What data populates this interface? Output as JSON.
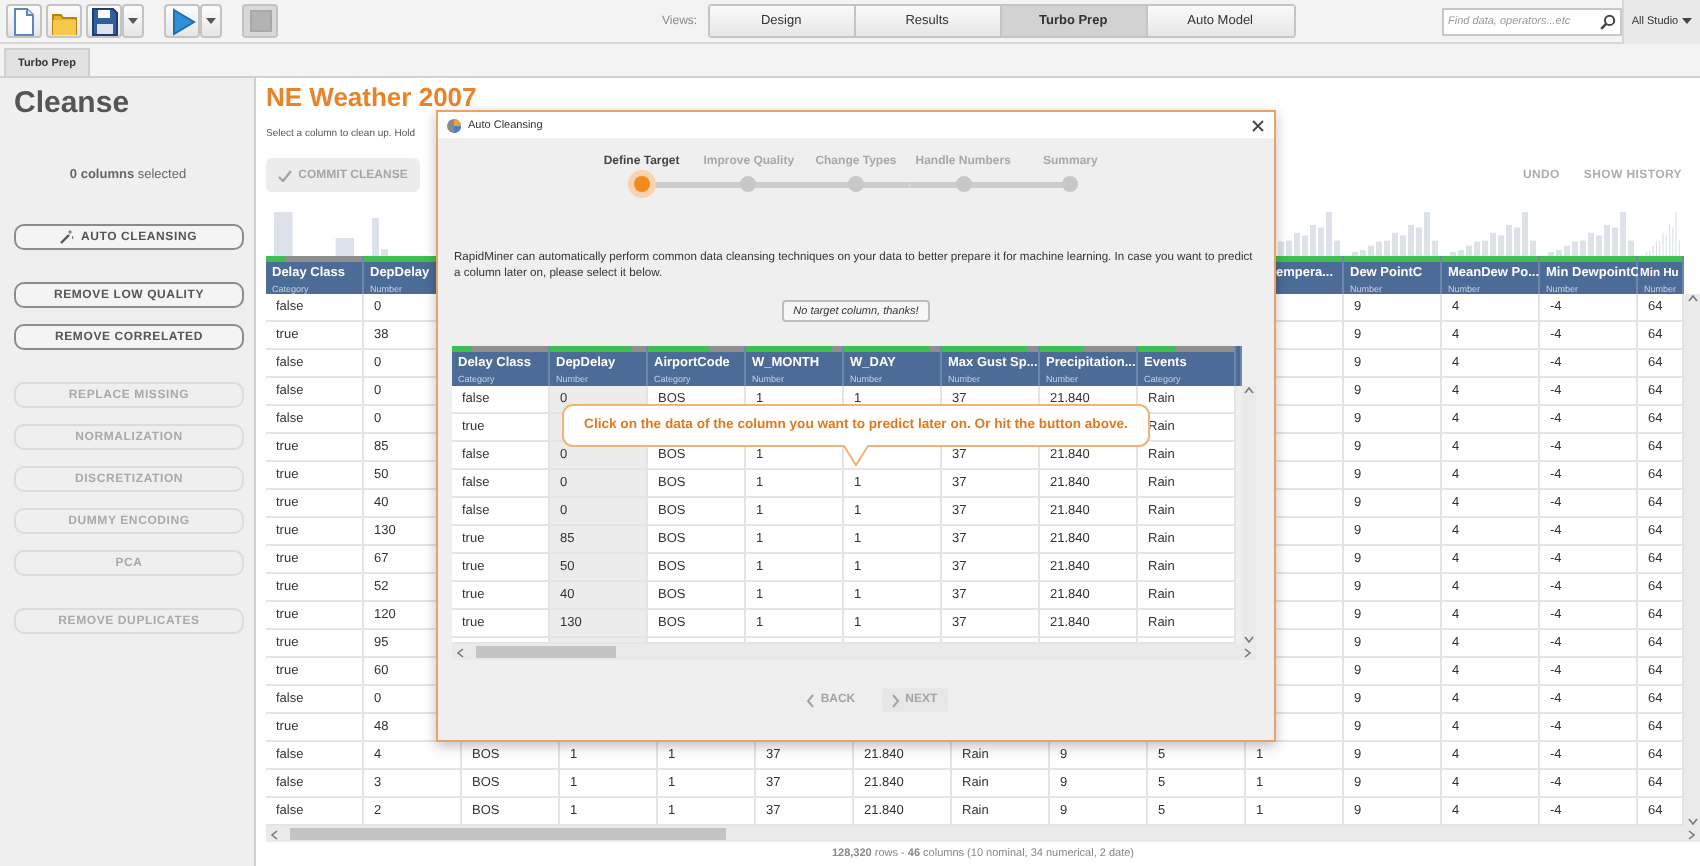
{
  "toolbar": {
    "buttons": [
      {
        "kind": "new",
        "disabled": false,
        "has_menu": false
      },
      {
        "kind": "open",
        "disabled": false,
        "has_menu": false
      },
      {
        "kind": "save",
        "disabled": false,
        "has_menu": true
      },
      {
        "kind": "run",
        "disabled": false,
        "has_menu": true
      },
      {
        "kind": "stop",
        "disabled": true,
        "has_menu": false
      }
    ],
    "views_label": "Views:",
    "views": [
      {
        "label": "Design",
        "selected": false
      },
      {
        "label": "Results",
        "selected": false
      },
      {
        "label": "Turbo Prep",
        "selected": true
      },
      {
        "label": "Auto Model",
        "selected": false
      }
    ],
    "search": {
      "placeholder": "Find data, operators...etc"
    },
    "scope": "All Studio"
  },
  "tab": {
    "label": "Turbo Prep"
  },
  "left_panel": {
    "title": "Cleanse",
    "selection": "**0 columns** selected",
    "button_groups": [
      [
        {
          "label": "AUTO CLEANSING",
          "kind": "wand",
          "disabled": false
        }
      ],
      [
        {
          "label": "REMOVE LOW QUALITY",
          "kind": "plain",
          "disabled": false
        },
        {
          "label": "REMOVE CORRELATED",
          "kind": "plain",
          "disabled": false
        }
      ],
      [
        {
          "label": "REPLACE MISSING",
          "kind": "plain",
          "disabled": true
        },
        {
          "label": "NORMALIZATION",
          "kind": "plain",
          "disabled": true
        },
        {
          "label": "DISCRETIZATION",
          "kind": "plain",
          "disabled": true
        },
        {
          "label": "DUMMY ENCODING",
          "kind": "plain",
          "disabled": true
        },
        {
          "label": "PCA",
          "kind": "plain",
          "disabled": true
        }
      ],
      [
        {
          "label": "REMOVE DUPLICATES",
          "kind": "plain",
          "disabled": true
        }
      ]
    ]
  },
  "main": {
    "title": "NE Weather 2007",
    "subtitle": "Select a column to clean up. Hold",
    "commit": {
      "label": "COMMIT CLEANSE",
      "disabled": true
    },
    "actions": [
      {
        "label": "UNDO",
        "disabled": true
      },
      {
        "label": "SHOW HISTORY",
        "disabled": true
      }
    ],
    "table": {
      "columns": [
        {
          "name": "Delay Class",
          "type": "Category",
          "level": 0.2
        },
        {
          "name": "DepDelay",
          "type": "Number",
          "level": 0.85
        },
        null,
        null,
        null,
        null,
        null,
        null,
        null,
        null,
        {
          "name": "empera...",
          "level": 1
        },
        {
          "name": "Dew PointC",
          "type": "Number",
          "level": 1
        },
        {
          "name": "MeanDew Po...",
          "type": "Number",
          "level": 1
        },
        {
          "name": "Min DewpointC",
          "type": "Number",
          "level": 1
        },
        {
          "name": "Min Hu",
          "type": "Number",
          "level": 1
        }
      ],
      "rows": [
        [
          "false",
          "0",
          null,
          null,
          null,
          null,
          null,
          null,
          null,
          null,
          null,
          "9",
          "4",
          "-4",
          "64"
        ],
        [
          "true",
          "38",
          null,
          null,
          null,
          null,
          null,
          null,
          null,
          null,
          null,
          "9",
          "4",
          "-4",
          "64"
        ],
        [
          "false",
          "0",
          null,
          null,
          null,
          null,
          null,
          null,
          null,
          null,
          null,
          "9",
          "4",
          "-4",
          "64"
        ],
        [
          "false",
          "0",
          null,
          null,
          null,
          null,
          null,
          null,
          null,
          null,
          null,
          "9",
          "4",
          "-4",
          "64"
        ],
        [
          "false",
          "0",
          null,
          null,
          null,
          null,
          null,
          null,
          null,
          null,
          null,
          "9",
          "4",
          "-4",
          "64"
        ],
        [
          "true",
          "85",
          null,
          null,
          null,
          null,
          null,
          null,
          null,
          null,
          null,
          "9",
          "4",
          "-4",
          "64"
        ],
        [
          "true",
          "50",
          null,
          null,
          null,
          null,
          null,
          null,
          null,
          null,
          null,
          "9",
          "4",
          "-4",
          "64"
        ],
        [
          "true",
          "40",
          null,
          null,
          null,
          null,
          null,
          null,
          null,
          null,
          null,
          "9",
          "4",
          "-4",
          "64"
        ],
        [
          "true",
          "130",
          null,
          null,
          null,
          null,
          null,
          null,
          null,
          null,
          null,
          "9",
          "4",
          "-4",
          "64"
        ],
        [
          "true",
          "67",
          null,
          null,
          null,
          null,
          null,
          null,
          null,
          null,
          null,
          "9",
          "4",
          "-4",
          "64"
        ],
        [
          "true",
          "52",
          null,
          null,
          null,
          null,
          null,
          null,
          null,
          null,
          null,
          "9",
          "4",
          "-4",
          "64"
        ],
        [
          "true",
          "120",
          null,
          null,
          null,
          null,
          null,
          null,
          null,
          null,
          null,
          "9",
          "4",
          "-4",
          "64"
        ],
        [
          "true",
          "95",
          null,
          null,
          null,
          null,
          null,
          null,
          null,
          null,
          null,
          "9",
          "4",
          "-4",
          "64"
        ],
        [
          "true",
          "60",
          null,
          null,
          null,
          null,
          null,
          null,
          null,
          null,
          null,
          "9",
          "4",
          "-4",
          "64"
        ],
        [
          "false",
          "0",
          null,
          null,
          null,
          null,
          null,
          null,
          null,
          null,
          null,
          "9",
          "4",
          "-4",
          "64"
        ],
        [
          "true",
          "48",
          null,
          null,
          null,
          null,
          null,
          null,
          null,
          null,
          null,
          "9",
          "4",
          "-4",
          "64"
        ],
        [
          "false",
          "4",
          "BOS",
          "1",
          "1",
          "37",
          "21.840",
          "Rain",
          "9",
          "5",
          "1",
          "9",
          "4",
          "-4",
          "64"
        ],
        [
          "false",
          "3",
          "BOS",
          "1",
          "1",
          "37",
          "21.840",
          "Rain",
          "9",
          "5",
          "1",
          "9",
          "4",
          "-4",
          "64"
        ],
        [
          "false",
          "2",
          "BOS",
          "1",
          "1",
          "37",
          "21.840",
          "Rain",
          "9",
          "5",
          "1",
          "9",
          "4",
          "-4",
          "64"
        ]
      ]
    },
    "status": "**128,320** rows - **46** columns (10 nominal, 34 numerical, 2 date)"
  },
  "dialog": {
    "title": "Auto Cleansing",
    "steps": [
      {
        "label": "Define Target",
        "selected": true
      },
      {
        "label": "Improve Quality",
        "selected": false
      },
      {
        "label": "Change Types",
        "selected": false
      },
      {
        "label": "Handle Numbers",
        "selected": false
      },
      {
        "label": "Summary",
        "selected": false
      }
    ],
    "description": "RapidMiner can automatically perform common data cleansing techniques on your data to better prepare it for machine learning. In case you want to predict a column later on, please select it below.",
    "no_target_button": "No target column, thanks!",
    "table": {
      "columns": [
        {
          "name": "Delay Class",
          "type": "Category",
          "level": 0.2,
          "hovered": false
        },
        {
          "name": "DepDelay",
          "type": "Number",
          "level": 0.85,
          "hovered": true
        },
        {
          "name": "AirportCode",
          "type": "Category",
          "level": 0.65,
          "hovered": false
        },
        {
          "name": "W_MONTH",
          "type": "Number",
          "level": 0.9,
          "hovered": false
        },
        {
          "name": "W_DAY",
          "type": "Number",
          "level": 0.9,
          "hovered": false
        },
        {
          "name": "Max Gust Sp...",
          "type": "Number",
          "level": 0.9,
          "hovered": false
        },
        {
          "name": "Precipitation...",
          "type": "Number",
          "level": 0.45,
          "hovered": false
        },
        {
          "name": "Events",
          "type": "Category",
          "level": 0.4,
          "hovered": false
        }
      ],
      "rows": [
        [
          "false",
          "0",
          "BOS",
          "1",
          "1",
          "37",
          "21.840",
          "Rain"
        ],
        [
          "true",
          null,
          null,
          null,
          null,
          null,
          null,
          "Rain"
        ],
        [
          "false",
          "0",
          "BOS",
          "1",
          null,
          "37",
          "21.840",
          "Rain"
        ],
        [
          "false",
          "0",
          "BOS",
          "1",
          "1",
          "37",
          "21.840",
          "Rain"
        ],
        [
          "false",
          "0",
          "BOS",
          "1",
          "1",
          "37",
          "21.840",
          "Rain"
        ],
        [
          "true",
          "85",
          "BOS",
          "1",
          "1",
          "37",
          "21.840",
          "Rain"
        ],
        [
          "true",
          "50",
          "BOS",
          "1",
          "1",
          "37",
          "21.840",
          "Rain"
        ],
        [
          "true",
          "40",
          "BOS",
          "1",
          "1",
          "37",
          "21.840",
          "Rain"
        ],
        [
          "true",
          "130",
          "BOS",
          "1",
          "1",
          "37",
          "21.840",
          "Rain"
        ]
      ]
    },
    "callout": "Click on the data of the column you want to predict later on. Or hit the button above.",
    "buttons": [
      {
        "label": "BACK",
        "kind": "back",
        "disabled": true
      },
      {
        "label": "NEXT",
        "kind": "next",
        "disabled": true
      }
    ]
  }
}
